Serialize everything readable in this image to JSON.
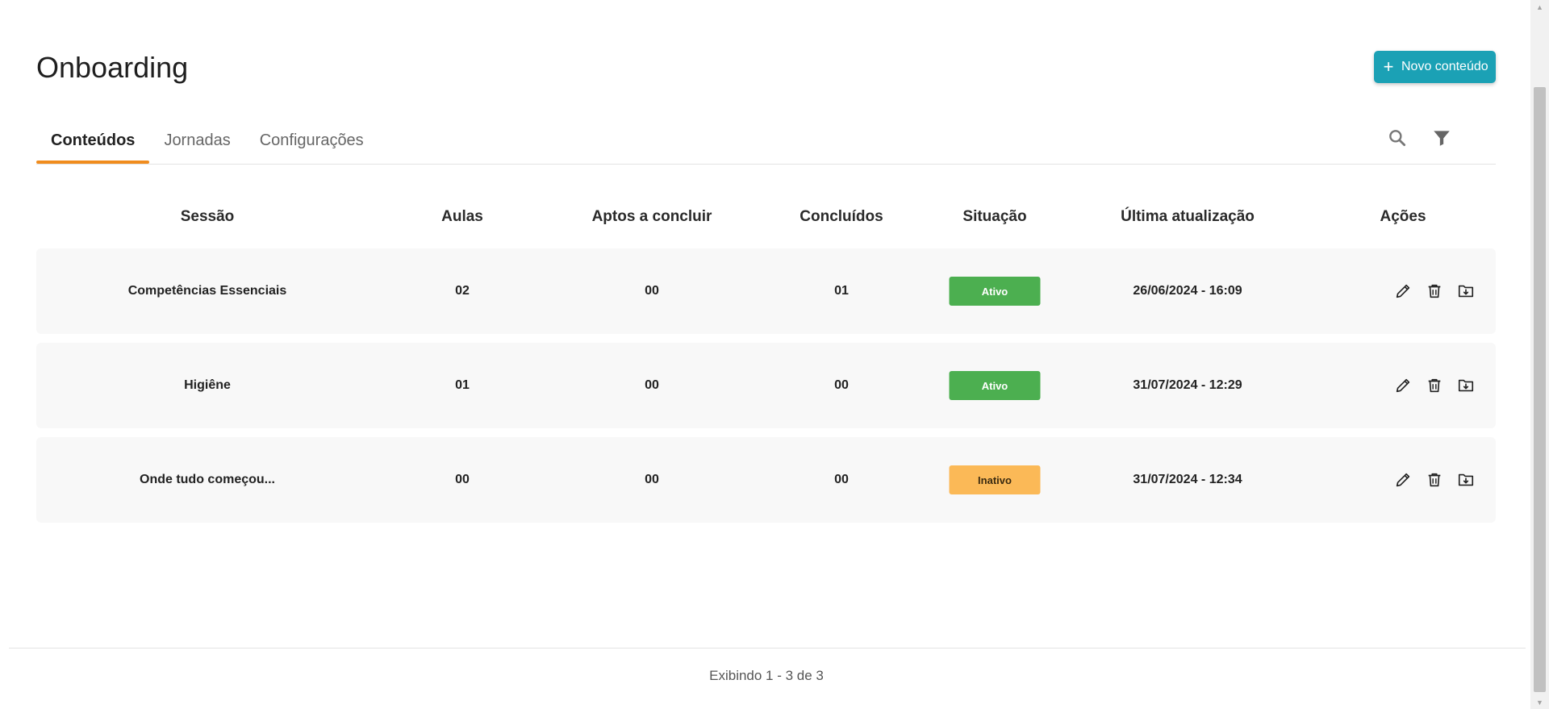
{
  "page": {
    "title": "Onboarding"
  },
  "actions": {
    "new_content_label": "Novo conteúdo"
  },
  "tabs": [
    {
      "label": "Conteúdos",
      "active": true
    },
    {
      "label": "Jornadas",
      "active": false
    },
    {
      "label": "Configurações",
      "active": false
    }
  ],
  "tools": {
    "search_icon": "search-icon",
    "filter_icon": "filter-icon"
  },
  "table": {
    "headers": [
      "Sessão",
      "Aulas",
      "Aptos a concluir",
      "Concluídos",
      "Situação",
      "Última atualização",
      "Ações"
    ],
    "rows": [
      {
        "sessao": "Competências Essenciais",
        "aulas": "02",
        "aptos": "00",
        "concluidos": "01",
        "situacao": "Ativo",
        "status": "active",
        "atualizacao": "26/06/2024 - 16:09"
      },
      {
        "sessao": "Higiêne",
        "aulas": "01",
        "aptos": "00",
        "concluidos": "00",
        "situacao": "Ativo",
        "status": "active",
        "atualizacao": "31/07/2024 - 12:29"
      },
      {
        "sessao": "Onde tudo começou...",
        "aulas": "00",
        "aptos": "00",
        "concluidos": "00",
        "situacao": "Inativo",
        "status": "inactive",
        "atualizacao": "31/07/2024 - 12:34"
      }
    ],
    "row_actions": [
      "edit-icon",
      "delete-icon",
      "export-icon"
    ]
  },
  "footer": {
    "pagination_text": "Exibindo 1 - 3 de 3"
  },
  "colors": {
    "accent": "#1ba1b5",
    "tab_indicator": "#f08c1e",
    "status_active": "#4caf50",
    "status_inactive": "#fbb957"
  }
}
